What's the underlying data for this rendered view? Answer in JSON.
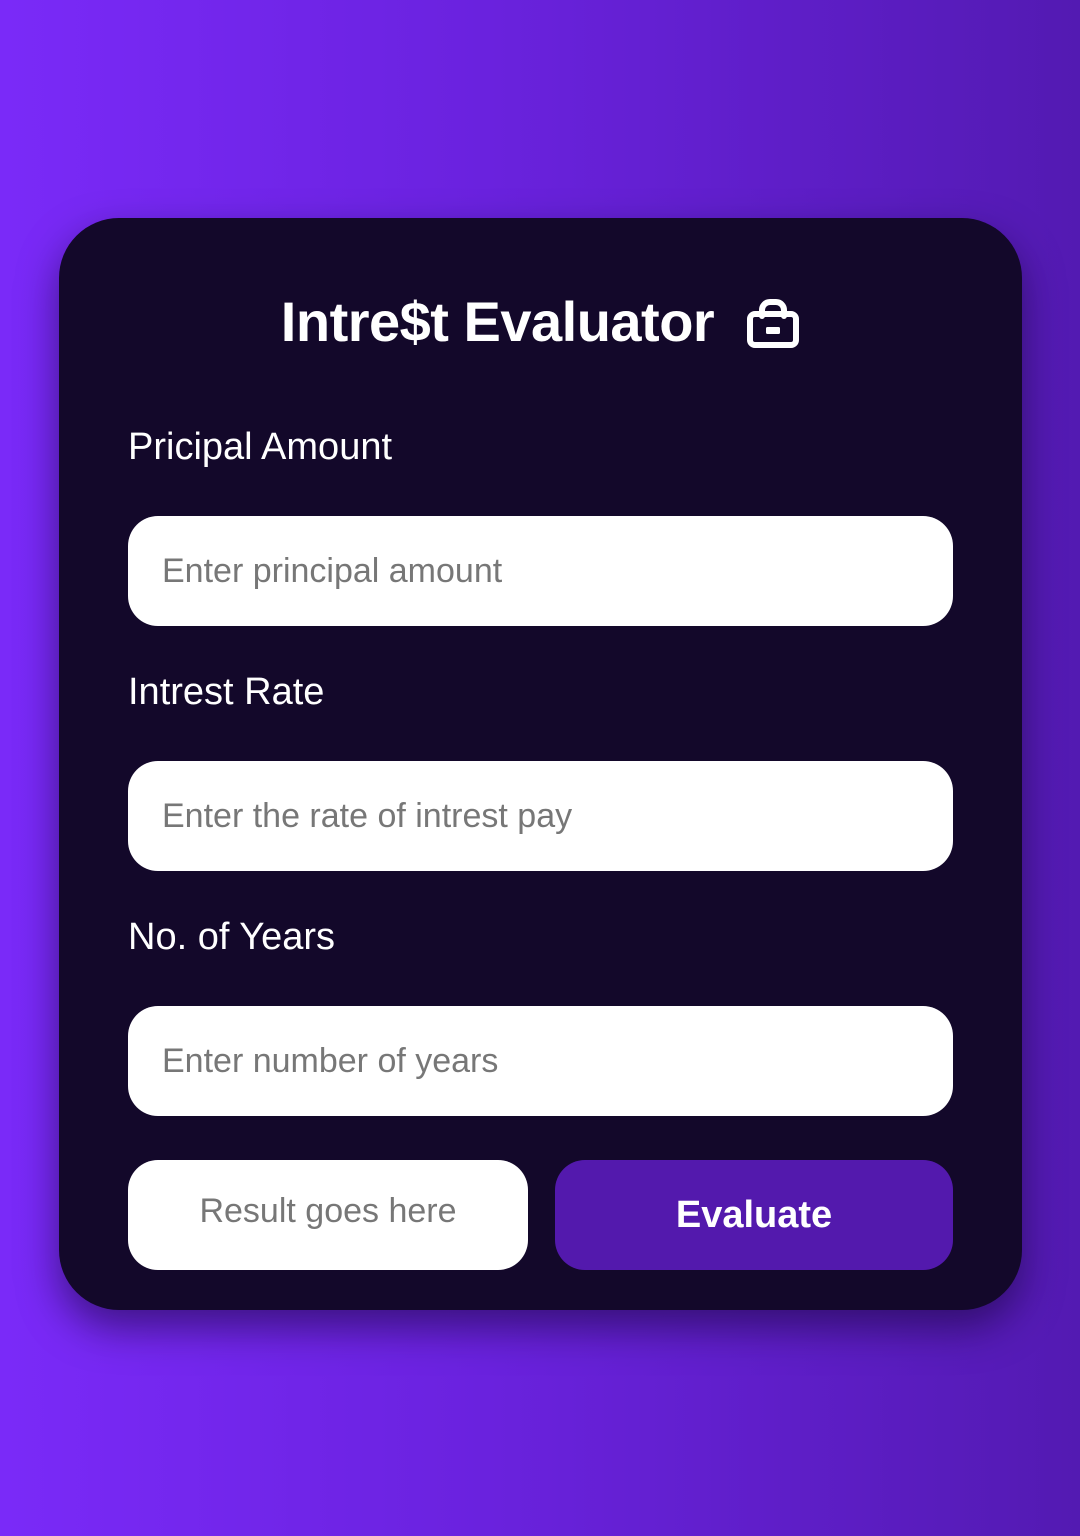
{
  "app": {
    "title": "Intre$t Evaluator",
    "title_icon": "lock-icon"
  },
  "fields": [
    {
      "label": "Pricipal Amount",
      "placeholder": "Enter principal amount",
      "value": ""
    },
    {
      "label": "Intrest Rate",
      "placeholder": "Enter the rate of intrest pay",
      "value": ""
    },
    {
      "label": "No. of Years",
      "placeholder": "Enter number of years",
      "value": ""
    }
  ],
  "result": {
    "text": "Result goes here"
  },
  "evaluate_button": {
    "label": "Evaluate"
  },
  "colors": {
    "background_gradient_start": "#7a2af8",
    "background_gradient_end": "#531ab2",
    "card": "#13082a",
    "button": "#5319ad",
    "input_background": "#ffffff",
    "placeholder_text": "#777777"
  }
}
